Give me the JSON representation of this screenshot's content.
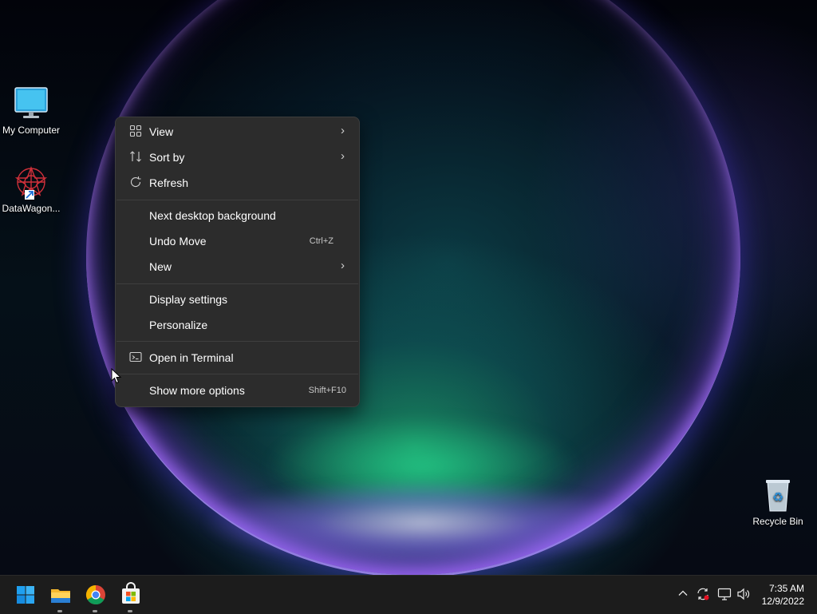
{
  "desktop": {
    "icons": [
      {
        "label": "My Computer"
      },
      {
        "label": "DataWagon..."
      },
      {
        "label": "Recycle Bin"
      }
    ]
  },
  "context_menu": {
    "items": [
      {
        "label": "View",
        "icon": "grid-icon",
        "submenu": true
      },
      {
        "label": "Sort by",
        "icon": "sort-icon",
        "submenu": true
      },
      {
        "label": "Refresh",
        "icon": "refresh-icon"
      },
      {
        "label": "Next desktop background"
      },
      {
        "label": "Undo Move",
        "shortcut": "Ctrl+Z"
      },
      {
        "label": "New",
        "submenu": true
      },
      {
        "label": "Display settings"
      },
      {
        "label": "Personalize"
      },
      {
        "label": "Open in Terminal",
        "icon": "terminal-icon"
      },
      {
        "label": "Show more options",
        "shortcut": "Shift+F10"
      }
    ]
  },
  "taskbar": {
    "apps": [
      "start",
      "file-explorer",
      "chrome",
      "microsoft-store"
    ],
    "clock": {
      "time": "7:35 AM",
      "date": "12/9/2022"
    }
  },
  "colors": {
    "menu_bg": "#2c2c2c",
    "taskbar_bg": "#1c1c1c",
    "accent": "#0078d4"
  }
}
